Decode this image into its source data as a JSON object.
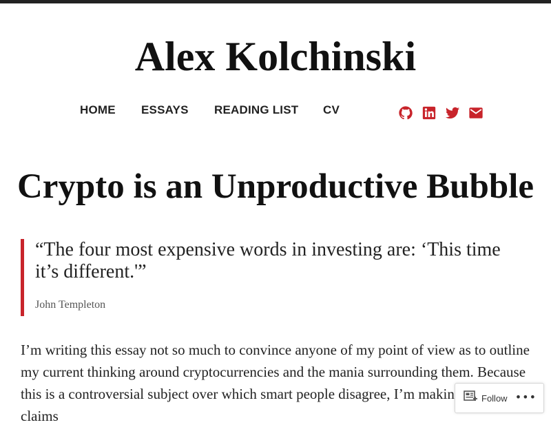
{
  "site": {
    "title": "Alex Kolchinski"
  },
  "nav": {
    "items": [
      {
        "label": "HOME"
      },
      {
        "label": "ESSAYS"
      },
      {
        "label": "READING LIST"
      },
      {
        "label": "CV"
      }
    ]
  },
  "social": {
    "color": "#c8242b",
    "icons": [
      "github-icon",
      "linkedin-icon",
      "twitter-icon",
      "mail-icon"
    ]
  },
  "post": {
    "title": "Crypto is an Unproductive Bubble",
    "quote": {
      "text": "“The four most expensive words in investing are: ‘This time it’s different.'”",
      "cite": "John Templeton"
    },
    "body": "I’m writing this essay not so much to convince anyone of my point of view as to outline my current thinking around cryptocurrencies and the mania surrounding them. Because this is a controversial subject over which smart people disagree, I’m making these claims"
  },
  "follow_widget": {
    "label": "Follow",
    "more": "•••"
  }
}
